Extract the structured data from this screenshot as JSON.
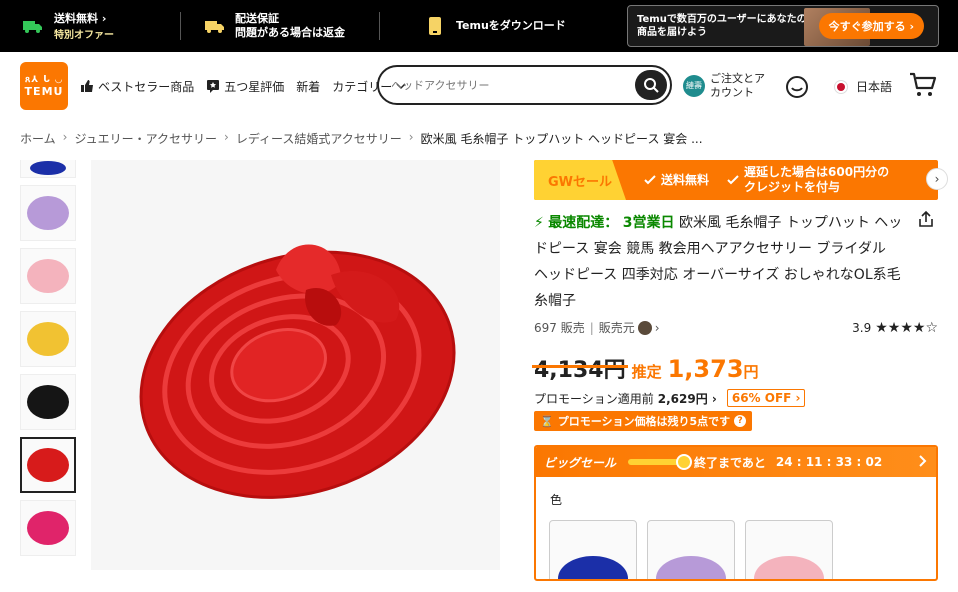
{
  "topbar": {
    "shipping_title": "送料無料 ›",
    "shipping_sub": "特別オファー",
    "guarantee_title": "配送保証",
    "guarantee_sub": "問題がある場合は返金",
    "download": "Temuをダウンロード",
    "promo_text": "Temuで数百万のユーザーにあなたの商品を届けよう",
    "promo_button": "今すぐ参加する ›"
  },
  "header": {
    "logo_line1": "ጸ⅄ ᒐ ◡",
    "logo_line2": "TEMU",
    "nav": [
      "ベストセラー商品",
      "五つ星評価",
      "新着",
      "カテゴリー"
    ],
    "search_placeholder": "ヘッドアクセサリー",
    "account_badge": "縺壽",
    "account_line1": "ご注文とア",
    "account_line2": "カウント",
    "language": "日本語"
  },
  "breadcrumb": [
    "ホーム",
    "ジュエリー・アクセサリー",
    "レディース結婚式アクセサリー",
    "欧米風 毛糸帽子 トップハット ヘッドピース 宴会 ..."
  ],
  "thumbnails": [
    {
      "color": "#1b2fa8"
    },
    {
      "color": "#b79ad8"
    },
    {
      "color": "#f4b3bd"
    },
    {
      "color": "#f1c232"
    },
    {
      "color": "#151515"
    },
    {
      "color": "#d71b1b",
      "active": true
    },
    {
      "color": "#e0246a"
    }
  ],
  "main_image_color": "#e02020",
  "product": {
    "gw_label": "GWセール",
    "gw_item1": "送料無料",
    "gw_item2_line1": "遅延した場合は600円分の",
    "gw_item2_line2": "クレジットを付与",
    "fast_label": "最速配達：",
    "fast_days": "3営業日",
    "title": "欧米風 毛糸帽子 トップハット ヘッドピース 宴会 競馬 教会用ヘアアクセサリー ブライダル ヘッドピース 四季対応 オーバーサイズ おしゃれなOL系毛糸帽子",
    "sold": "697 販売",
    "seller": "販売元",
    "rating": "3.9",
    "stars": "★★★★☆",
    "old_price": "4,134円",
    "est_label": "推定",
    "new_price": "1,373",
    "currency": "円",
    "promo_before_label": "プロモーション適用前",
    "promo_before_price": "2,629円 ›",
    "off": "66% OFF ›",
    "remain": "プロモーション価格は残り5点です"
  },
  "bigsale": {
    "label": "ビッグセール",
    "ends_label": "終了まであと",
    "countdown": "24 : 11 : 33 : 02",
    "color_label": "色",
    "swatches": [
      "#1b2fa8",
      "#b79ad8",
      "#f4b3bd"
    ]
  }
}
